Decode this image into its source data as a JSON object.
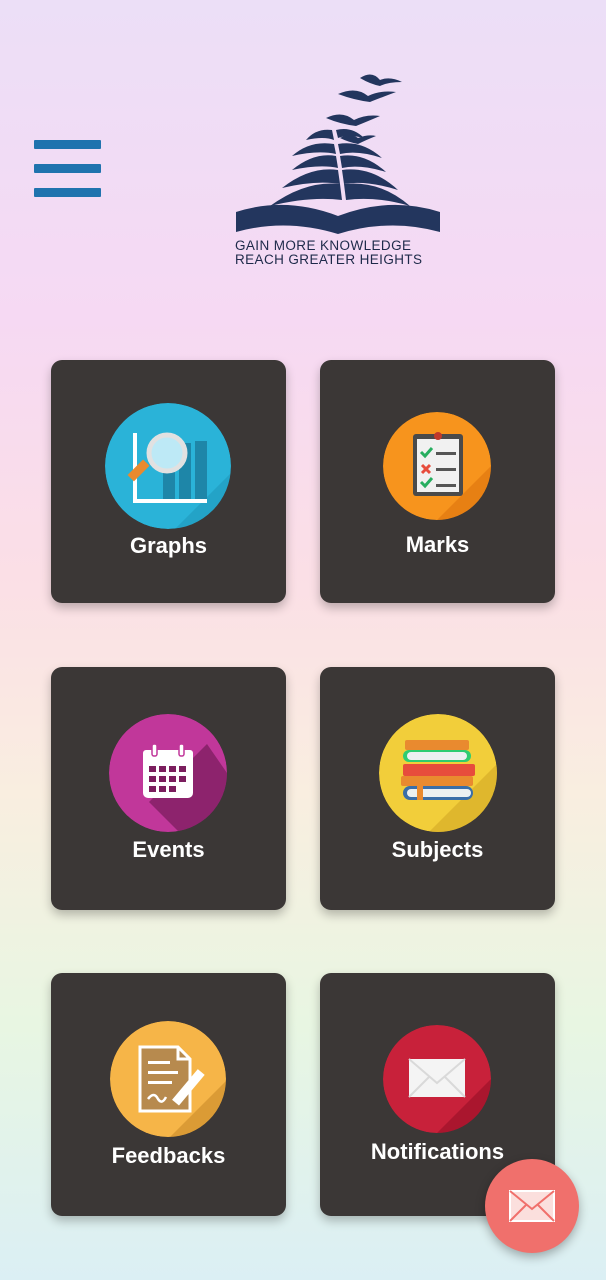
{
  "header": {
    "menu_icon": "hamburger-menu-icon",
    "logo": {
      "icon": "open-book-with-birds-logo",
      "tagline_line1": "GAIN MORE KNOWLEDGE",
      "tagline_line2": "REACH GREATER HEIGHTS",
      "color": "#23365e"
    }
  },
  "tiles": [
    {
      "label": "Graphs",
      "icon": "graph-magnifier-icon",
      "color": "#2ab3d8"
    },
    {
      "label": "Marks",
      "icon": "checklist-clipboard-icon",
      "color": "#f7941d"
    },
    {
      "label": "Events",
      "icon": "calendar-icon",
      "color": "#c1379a"
    },
    {
      "label": "Subjects",
      "icon": "books-stack-icon",
      "color": "#f2ce3a"
    },
    {
      "label": "Feedbacks",
      "icon": "document-pen-icon",
      "color": "#f6b548"
    },
    {
      "label": "Notifications",
      "icon": "envelope-icon",
      "color": "#c8213a"
    }
  ],
  "fab": {
    "icon": "envelope-icon",
    "color": "#f0706c"
  },
  "theme": {
    "card_bg": "#3b3736",
    "menu_color": "#1f73ae"
  }
}
